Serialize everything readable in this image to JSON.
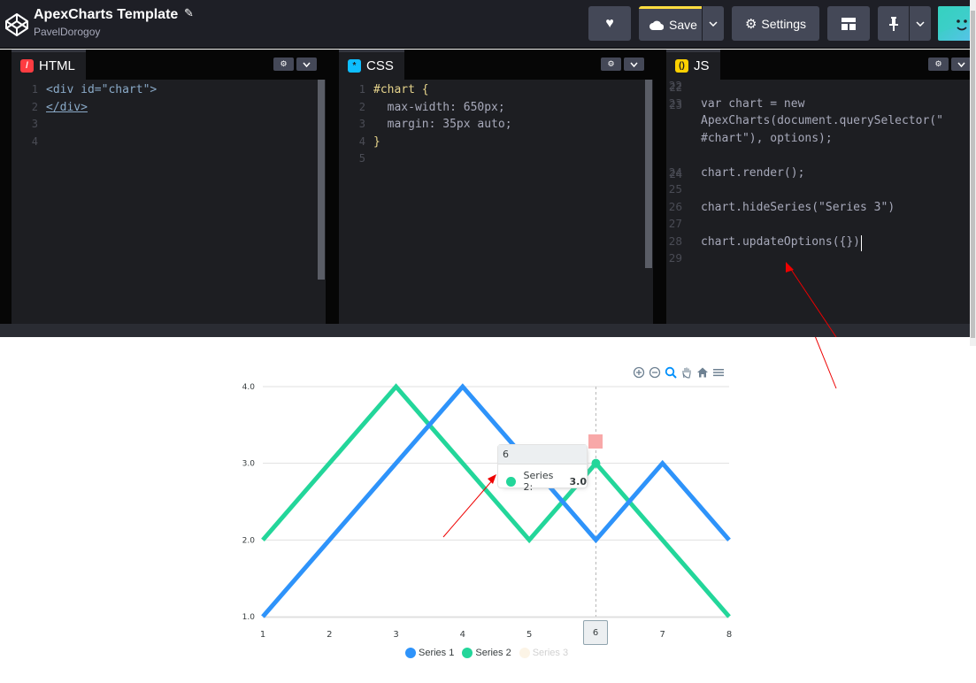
{
  "header": {
    "title": "ApexCharts Template",
    "author": "PavelDorogoy",
    "save_label": "Save",
    "settings_label": "Settings",
    "icons": {
      "logo": "codepen-logo-icon",
      "edit": "pencil-icon",
      "heart": "heart-icon",
      "cloud": "cloud-icon",
      "caret": "chevron-down-icon",
      "gear": "gear-icon",
      "layout": "layout-grid-icon",
      "pin": "pin-icon"
    },
    "accent_color": "#ffdd40"
  },
  "editors": [
    {
      "tab": "HTML",
      "icon_color": "#ff3c41",
      "lines": [
        {
          "n": "1",
          "text": "<div id=\"chart\">"
        },
        {
          "n": "2",
          "text": "</div>"
        },
        {
          "n": "3",
          "text": ""
        },
        {
          "n": "4",
          "text": ""
        }
      ]
    },
    {
      "tab": "CSS",
      "icon_color": "#0ebeff",
      "lines": [
        {
          "n": "1",
          "text": "#chart {"
        },
        {
          "n": "2",
          "text": "  max-width: 650px;"
        },
        {
          "n": "3",
          "text": "  margin: 35px auto;"
        },
        {
          "n": "4",
          "text": "}"
        },
        {
          "n": "5",
          "text": ""
        }
      ]
    },
    {
      "tab": "JS",
      "icon_color": "#fcd000",
      "lines": [
        {
          "n": "22",
          "text": ""
        },
        {
          "n": "23",
          "text": "var chart = new"
        },
        {
          "n": "",
          "text": "ApexCharts(document.querySelector(\""
        },
        {
          "n": "",
          "text": "#chart\"), options);"
        },
        {
          "n": "24",
          "text": ""
        },
        {
          "n": "25",
          "text": "chart.render();"
        },
        {
          "n": "26",
          "text": ""
        },
        {
          "n": "27",
          "text": "chart.hideSeries(\"Series 3\")"
        },
        {
          "n": "28",
          "text": ""
        },
        {
          "n": "29",
          "text": "chart.updateOptions({})"
        }
      ]
    }
  ],
  "chart_data": {
    "type": "line",
    "x": [
      1,
      2,
      3,
      4,
      5,
      6,
      7,
      8
    ],
    "xlim": [
      1,
      8
    ],
    "ylim": [
      1,
      4
    ],
    "yticks": [
      "1.0",
      "2.0",
      "3.0",
      "4.0"
    ],
    "xticks": [
      "1",
      "2",
      "3",
      "4",
      "5",
      "6",
      "7",
      "8"
    ],
    "grid": true,
    "legend_position": "bottom",
    "series": [
      {
        "name": "Series 1",
        "color": "#2e93fa",
        "values": [
          1,
          2,
          3,
          4,
          3,
          2,
          3,
          2
        ],
        "hidden": false
      },
      {
        "name": "Series 2",
        "color": "#23d69a",
        "values": [
          2,
          3,
          4,
          3,
          2,
          3,
          2,
          1
        ],
        "hidden": false
      },
      {
        "name": "Series 3",
        "color": "#f9e7c8",
        "values": [],
        "hidden": true
      }
    ],
    "tooltip": {
      "title": "6",
      "series": "Series 2:",
      "value": "3.0"
    },
    "crosshair_label": "6",
    "toolbar_icons": [
      "zoom-in-icon",
      "zoom-out-icon",
      "magnifier-icon",
      "pan-hand-icon",
      "home-icon",
      "menu-icon"
    ]
  }
}
